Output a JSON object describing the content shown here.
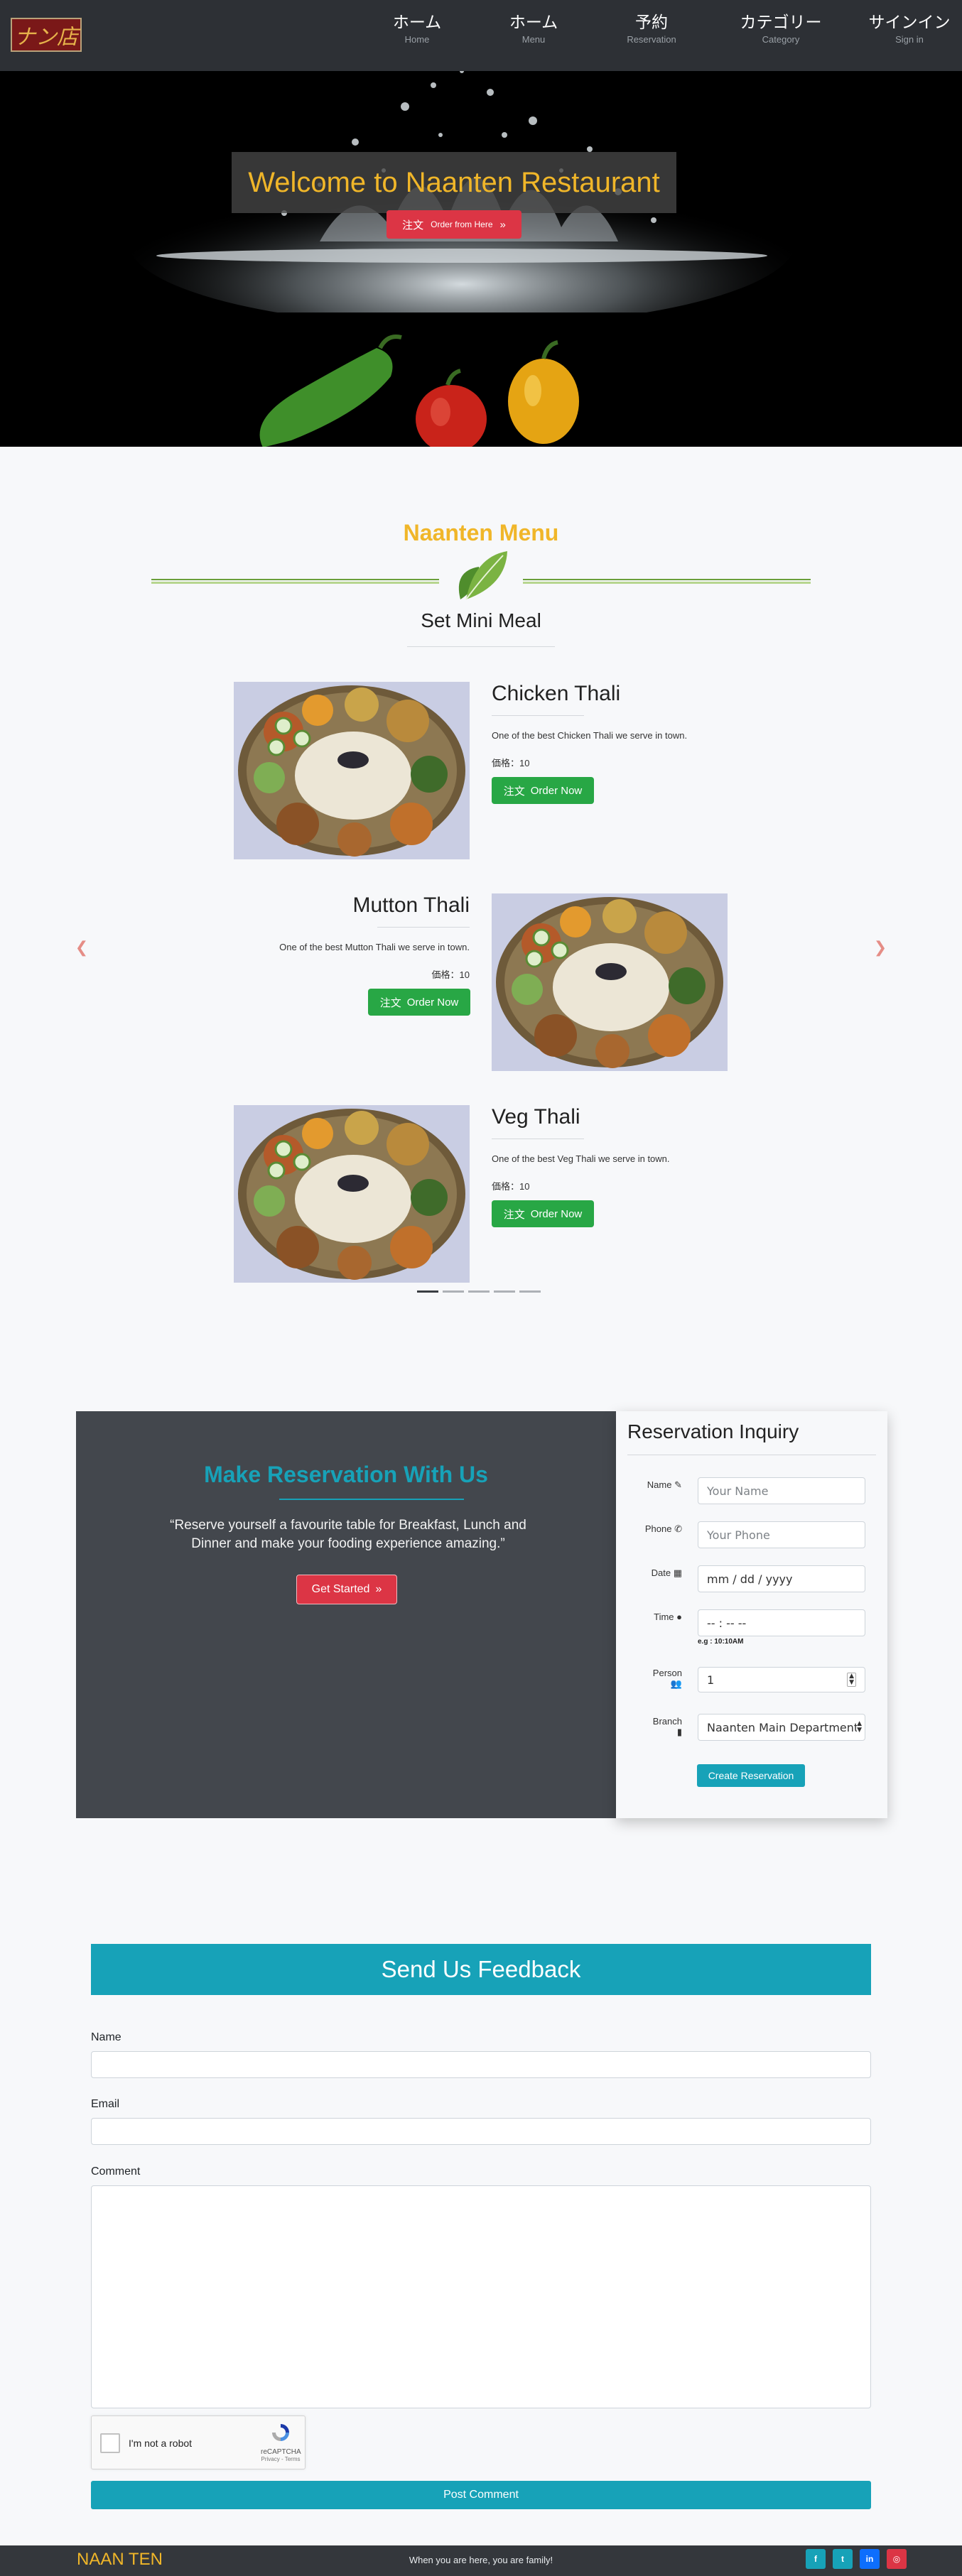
{
  "brand": {
    "logo_text": "ナン店"
  },
  "nav": {
    "items": [
      {
        "main": "ホーム",
        "sub": "Home"
      },
      {
        "main": "ホーム",
        "sub": "Menu"
      },
      {
        "main": "予約",
        "sub": "Reservation"
      },
      {
        "main": "カテゴリー",
        "sub": "Category"
      },
      {
        "main": "サインイン",
        "sub": "Sign in"
      }
    ]
  },
  "hero": {
    "title": "Welcome to Naanten Restaurant",
    "button_ja": "注文",
    "button_en": "Order from Here",
    "button_icon": "double-chevron-right-icon"
  },
  "menu": {
    "title": "Naanten Menu",
    "subtitle": "Set Mini Meal",
    "items": [
      {
        "name": "Chicken Thali",
        "desc": "One of the best Chicken Thali we serve in town.",
        "price_label": "価格：",
        "price": "10",
        "btn_ja": "注文",
        "btn_en": "Order Now"
      },
      {
        "name": "Mutton Thali",
        "desc": "One of the best Mutton Thali we serve in town.",
        "price_label": "価格：",
        "price": "10",
        "btn_ja": "注文",
        "btn_en": "Order Now"
      },
      {
        "name": "Veg Thali",
        "desc": "One of the best Veg Thali we serve in town.",
        "price_label": "価格：",
        "price": "10",
        "btn_ja": "注文",
        "btn_en": "Order Now"
      }
    ],
    "prev_icon": "chevron-left-icon",
    "next_icon": "chevron-right-icon",
    "indicator_count": 5,
    "active_indicator": 0
  },
  "reservation": {
    "title": "Make Reservation With Us",
    "quote": "“Reserve yourself a favourite table for Breakfast, Lunch and Dinner and make your fooding experience amazing.”",
    "get_started": "Get Started",
    "form": {
      "title": "Reservation Inquiry",
      "name_label": "Name",
      "name_placeholder": "Your Name",
      "phone_label": "Phone",
      "phone_placeholder": "Your Phone",
      "date_label": "Date",
      "date_placeholder": "mm / dd / yyyy",
      "time_label": "Time",
      "time_placeholder": "-- : --  --",
      "time_hint": "e.g : 10:10AM",
      "person_label": "Person",
      "person_value": "1",
      "branch_label": "Branch",
      "branch_value": "Naanten Main Department",
      "submit": "Create Reservation"
    }
  },
  "feedback": {
    "title": "Send Us Feedback",
    "name_label": "Name",
    "email_label": "Email",
    "comment_label": "Comment",
    "recaptcha_text": "I'm not a robot",
    "recaptcha_brand": "reCAPTCHA",
    "recaptcha_terms": "Privacy - Terms",
    "submit": "Post Comment"
  },
  "footer": {
    "brand": "NAAN TEN",
    "tagline": "When you are here, you are family!",
    "social": [
      {
        "name": "facebook-icon",
        "glyph": "f",
        "color": "#17a2b8"
      },
      {
        "name": "twitter-icon",
        "glyph": "t",
        "color": "#17a2b8"
      },
      {
        "name": "linkedin-icon",
        "glyph": "in",
        "color": "#0d6efd"
      },
      {
        "name": "instagram-icon",
        "glyph": "◎",
        "color": "#dc3545"
      }
    ]
  },
  "colors": {
    "navbar": "#2d3035",
    "accent_gold": "#f0b629",
    "teal": "#17a2b8",
    "green": "#28a745",
    "red": "#dc3545"
  }
}
